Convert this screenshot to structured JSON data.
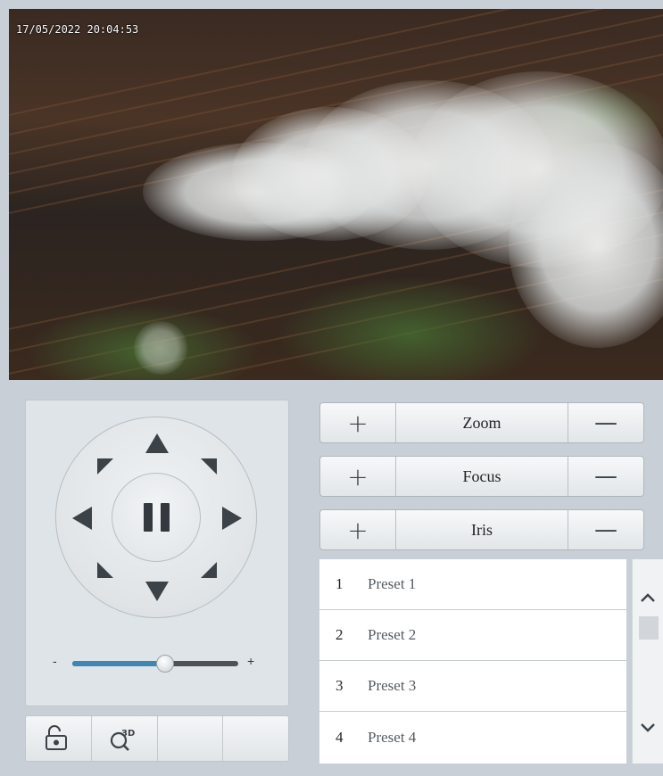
{
  "video": {
    "timestamp": "17/05/2022 20:04:53"
  },
  "ptz": {
    "speed": {
      "minus_label": "-",
      "plus_label": "+",
      "value": 0.56
    },
    "tools": [
      {
        "icon": "area-focus-icon"
      },
      {
        "icon": "3d-positioning-icon"
      },
      {
        "icon": ""
      },
      {
        "icon": ""
      }
    ]
  },
  "lens": {
    "zoom": {
      "label": "Zoom",
      "plus": "+",
      "minus": "—"
    },
    "focus": {
      "label": "Focus",
      "plus": "+",
      "minus": "—"
    },
    "iris": {
      "label": "Iris",
      "plus": "+",
      "minus": "—"
    }
  },
  "presets": [
    {
      "num": "1",
      "name": "Preset 1"
    },
    {
      "num": "2",
      "name": "Preset 2"
    },
    {
      "num": "3",
      "name": "Preset 3"
    },
    {
      "num": "4",
      "name": "Preset 4"
    }
  ],
  "colors": {
    "panel_bg": "#c9cfd6",
    "slider_fill": "#3f86b2",
    "icon_dark": "#3b4248"
  }
}
